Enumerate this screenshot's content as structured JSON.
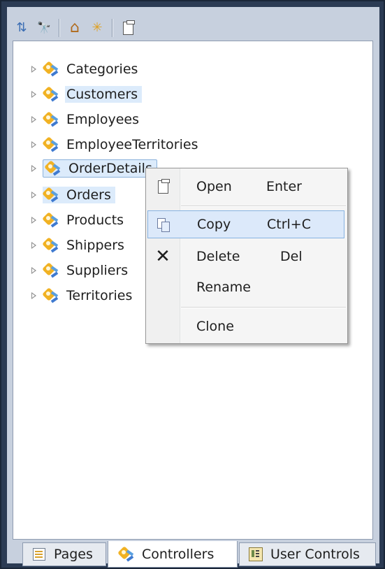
{
  "toolbar": {
    "buttons": [
      {
        "name": "sync-icon",
        "glyph": "⇅"
      },
      {
        "name": "find-icon",
        "glyph": "🔭"
      },
      {
        "name": "home-icon",
        "glyph": "⌂"
      },
      {
        "name": "new-controller-icon",
        "glyph": "✳"
      },
      {
        "name": "properties-icon",
        "glyph": "▯"
      }
    ]
  },
  "tree": {
    "items": [
      {
        "label": "Categories"
      },
      {
        "label": "Customers"
      },
      {
        "label": "Employees"
      },
      {
        "label": "EmployeeTerritories"
      },
      {
        "label": "OrderDetails"
      },
      {
        "label": "Orders"
      },
      {
        "label": "Products"
      },
      {
        "label": "Shippers"
      },
      {
        "label": "Suppliers"
      },
      {
        "label": "Territories"
      }
    ]
  },
  "context_menu": {
    "items": [
      {
        "label": "Open",
        "shortcut": "Enter"
      },
      {
        "label": "Copy",
        "shortcut": "Ctrl+C"
      },
      {
        "label": "Delete",
        "shortcut": "Del"
      },
      {
        "label": "Rename",
        "shortcut": ""
      },
      {
        "label": "Clone",
        "shortcut": ""
      }
    ]
  },
  "tabs": {
    "pages": "Pages",
    "controllers": "Controllers",
    "user_controls": "User Controls"
  },
  "colors": {
    "frame": "#2b3b54",
    "selection": "#dcebfb",
    "menu_hover": "#dce9fa"
  }
}
